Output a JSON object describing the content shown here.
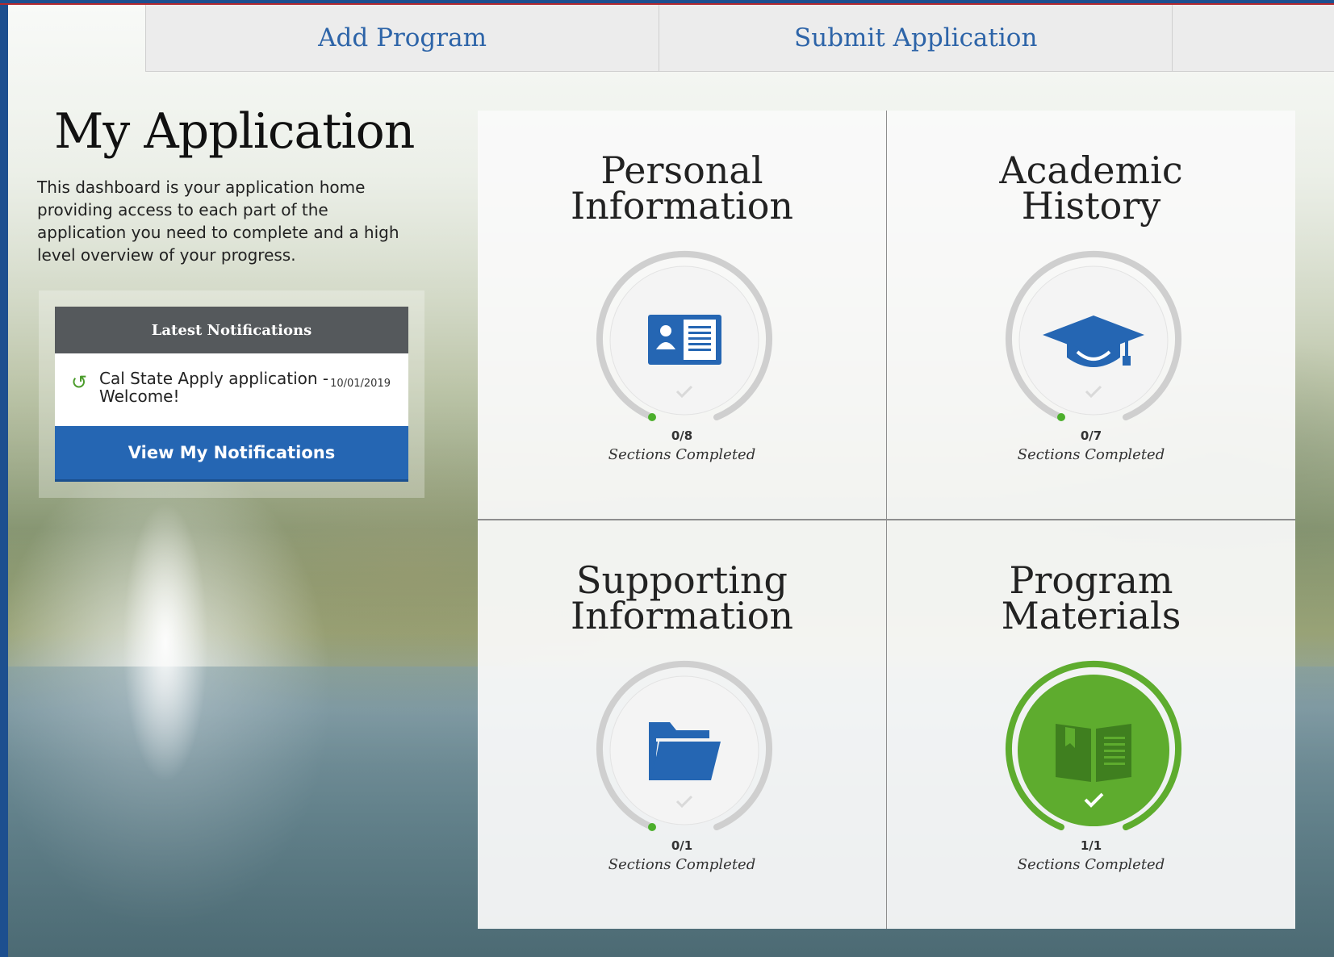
{
  "nav": {
    "items": [
      {
        "label": "Add Program"
      },
      {
        "label": "Submit Application"
      },
      {
        "label": ""
      }
    ]
  },
  "page": {
    "title": "My Application",
    "intro": "This dashboard is your application home providing access to each part of the application you need to complete and a high level overview of your progress."
  },
  "notifications": {
    "header": "Latest Notifications",
    "items": [
      {
        "icon": "refresh-icon",
        "text": "Cal State Apply application - Welcome!",
        "date": "10/01/2019"
      }
    ],
    "button_label": "View My Notifications"
  },
  "quadrants": [
    {
      "title_line1": "Personal",
      "title_line2": "Information",
      "icon": "id-card-icon",
      "completed": 0,
      "total": 8,
      "progress_label": "0/8",
      "caption": "Sections Completed",
      "status_color": "#cfcfcf"
    },
    {
      "title_line1": "Academic",
      "title_line2": "History",
      "icon": "graduation-cap-icon",
      "completed": 0,
      "total": 7,
      "progress_label": "0/7",
      "caption": "Sections Completed",
      "status_color": "#cfcfcf"
    },
    {
      "title_line1": "Supporting",
      "title_line2": "Information",
      "icon": "folder-icon",
      "completed": 0,
      "total": 1,
      "progress_label": "0/1",
      "caption": "Sections Completed",
      "status_color": "#cfcfcf"
    },
    {
      "title_line1": "Program",
      "title_line2": "Materials",
      "icon": "book-icon",
      "completed": 1,
      "total": 1,
      "progress_label": "1/1",
      "caption": "Sections Completed",
      "status_color": "#5eac2e"
    }
  ],
  "colors": {
    "brand_blue": "#2566b3",
    "nav_text": "#2d64a8",
    "complete_green": "#5eac2e",
    "progress_dot": "#4caf2c",
    "ring_gray": "#cfcfcf"
  }
}
